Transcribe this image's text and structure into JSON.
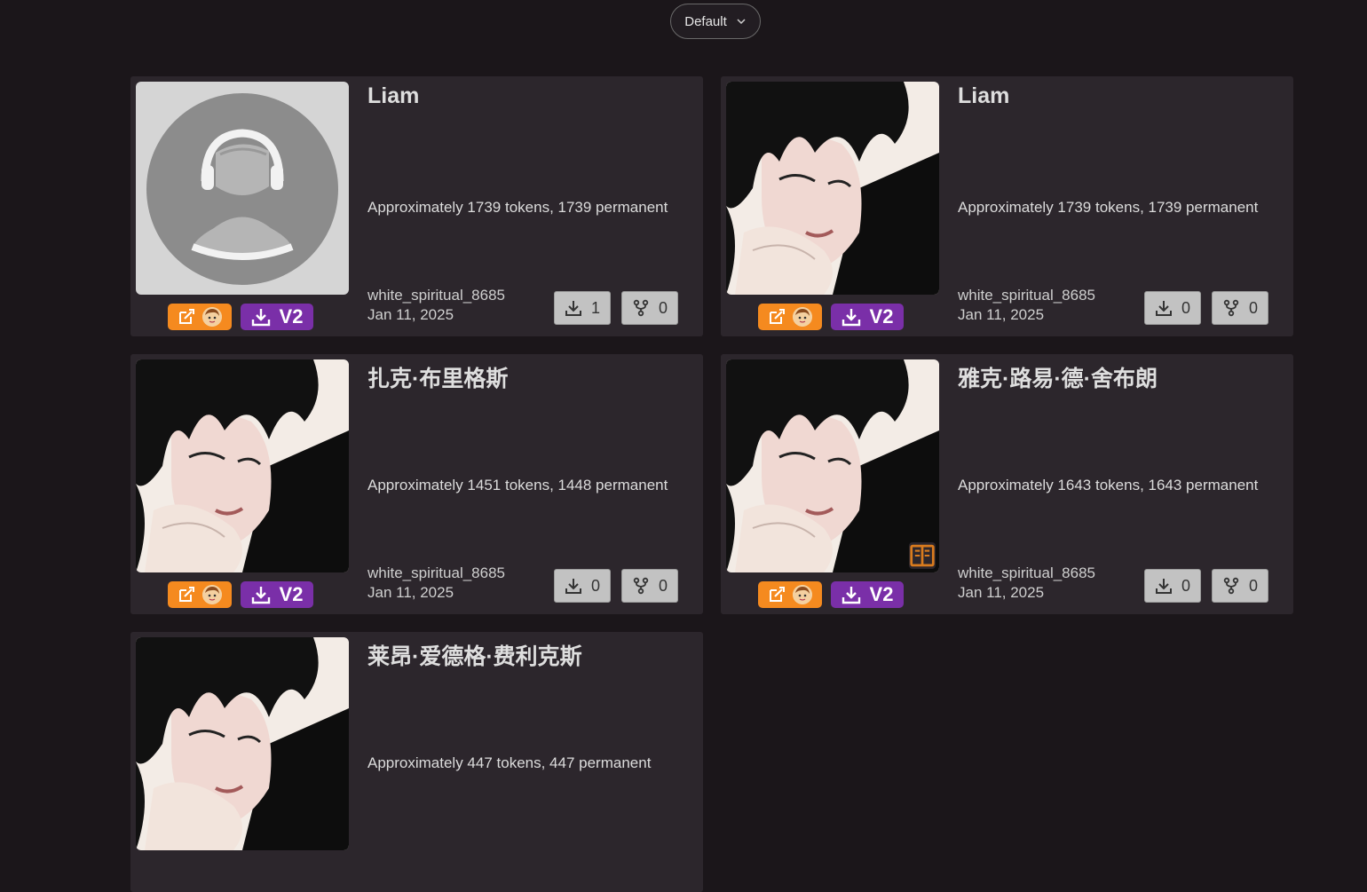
{
  "sort": {
    "label": "Default"
  },
  "cards": [
    {
      "title": "Liam",
      "tokens": "Approximately 1739 tokens, 1739 permanent",
      "author": "white_spiritual_8685",
      "date": "Jan 11, 2025",
      "downloads": "1",
      "forks": "0",
      "badge": "V2",
      "avatar": "placeholder-avatar"
    },
    {
      "title": "Liam",
      "tokens": "Approximately 1739 tokens, 1739 permanent",
      "author": "white_spiritual_8685",
      "date": "Jan 11, 2025",
      "downloads": "0",
      "forks": "0",
      "badge": "V2",
      "avatar": "character-portrait"
    },
    {
      "title": "扎克·布里格斯",
      "tokens": "Approximately 1451 tokens, 1448 permanent",
      "author": "white_spiritual_8685",
      "date": "Jan 11, 2025",
      "downloads": "0",
      "forks": "0",
      "badge": "V2",
      "avatar": "character-portrait"
    },
    {
      "title": "雅克·路易·德·舍布朗",
      "tokens": "Approximately 1643 tokens, 1643 permanent",
      "author": "white_spiritual_8685",
      "date": "Jan 11, 2025",
      "downloads": "0",
      "forks": "0",
      "badge": "V2",
      "avatar": "character-portrait",
      "lorebook": "book-icon"
    },
    {
      "title": "莱昂·爱德格·费利克斯",
      "tokens": "Approximately 447 tokens, 447 permanent",
      "avatar": "character-portrait"
    }
  ],
  "colors": {
    "background": "#1b161a",
    "card": "#2c262c",
    "edit_badge": "#f58a1f",
    "version_badge": "#7a2fa8",
    "stat_button": "#c2c2c2"
  },
  "icons": {
    "edit": "edit-icon",
    "download": "download-icon",
    "fork": "fork-icon",
    "chevron": "chevron-down-icon"
  }
}
